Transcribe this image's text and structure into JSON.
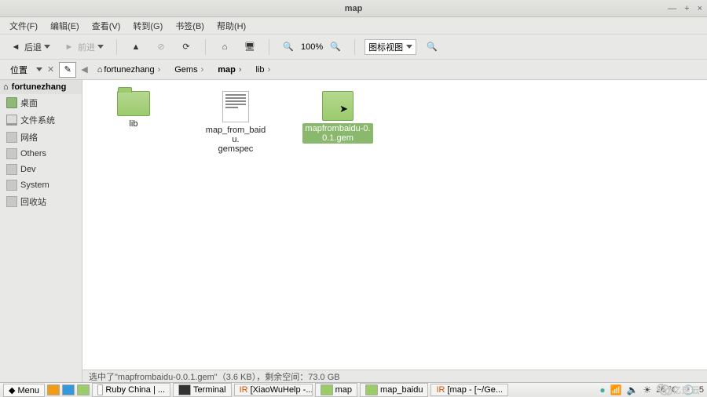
{
  "window": {
    "title": "map",
    "controls": {
      "min": "—",
      "max": "+",
      "close": "×"
    }
  },
  "menubar": [
    "文件(F)",
    "编辑(E)",
    "查看(V)",
    "转到(G)",
    "书签(B)",
    "帮助(H)"
  ],
  "toolbar": {
    "back": "后退",
    "forward": "前进",
    "zoom": "100%",
    "view_mode": "图标视图"
  },
  "locbar": {
    "root_label": "位置",
    "crumbs": [
      {
        "icon": "home",
        "label": "fortunezhang"
      },
      {
        "label": "Gems"
      },
      {
        "label": "map",
        "active": true
      },
      {
        "label": "lib"
      }
    ]
  },
  "sidebar": {
    "header": "fortunezhang",
    "items": [
      {
        "label": "桌面",
        "icon": "folder"
      },
      {
        "label": "文件系统",
        "icon": "drive"
      },
      {
        "label": "网络",
        "icon": "gray"
      },
      {
        "label": "Others",
        "icon": "gray"
      },
      {
        "label": "Dev",
        "icon": "gray"
      },
      {
        "label": "System",
        "icon": "gray"
      },
      {
        "label": "回收站",
        "icon": "gray"
      }
    ]
  },
  "files": [
    {
      "name": "lib",
      "kind": "folder",
      "selected": false
    },
    {
      "name": "map_from_baidu.\ngemspec",
      "kind": "doc",
      "selected": false
    },
    {
      "name": "mapfrombaidu-0.0.1.gem",
      "kind": "gem",
      "selected": true
    }
  ],
  "status": "选中了\"mapfrombaidu-0.0.1.gem\"（3.6 KB），剩余空间：73.0 GB",
  "taskbar": {
    "menu": "Menu",
    "tasks": [
      {
        "label": "Ruby China | ...",
        "icon": "w"
      },
      {
        "label": "Terminal",
        "icon": "bk"
      },
      {
        "label": "[XiaoWuHelp -...",
        "icon": "o"
      },
      {
        "label": "map",
        "icon": "g"
      },
      {
        "label": "map_baidu",
        "icon": "g"
      },
      {
        "label": "[map - [~/Ge...",
        "icon": "w"
      }
    ],
    "tray": {
      "temp": "26 °C",
      "time": "5"
    }
  },
  "watermark": "亿速云"
}
